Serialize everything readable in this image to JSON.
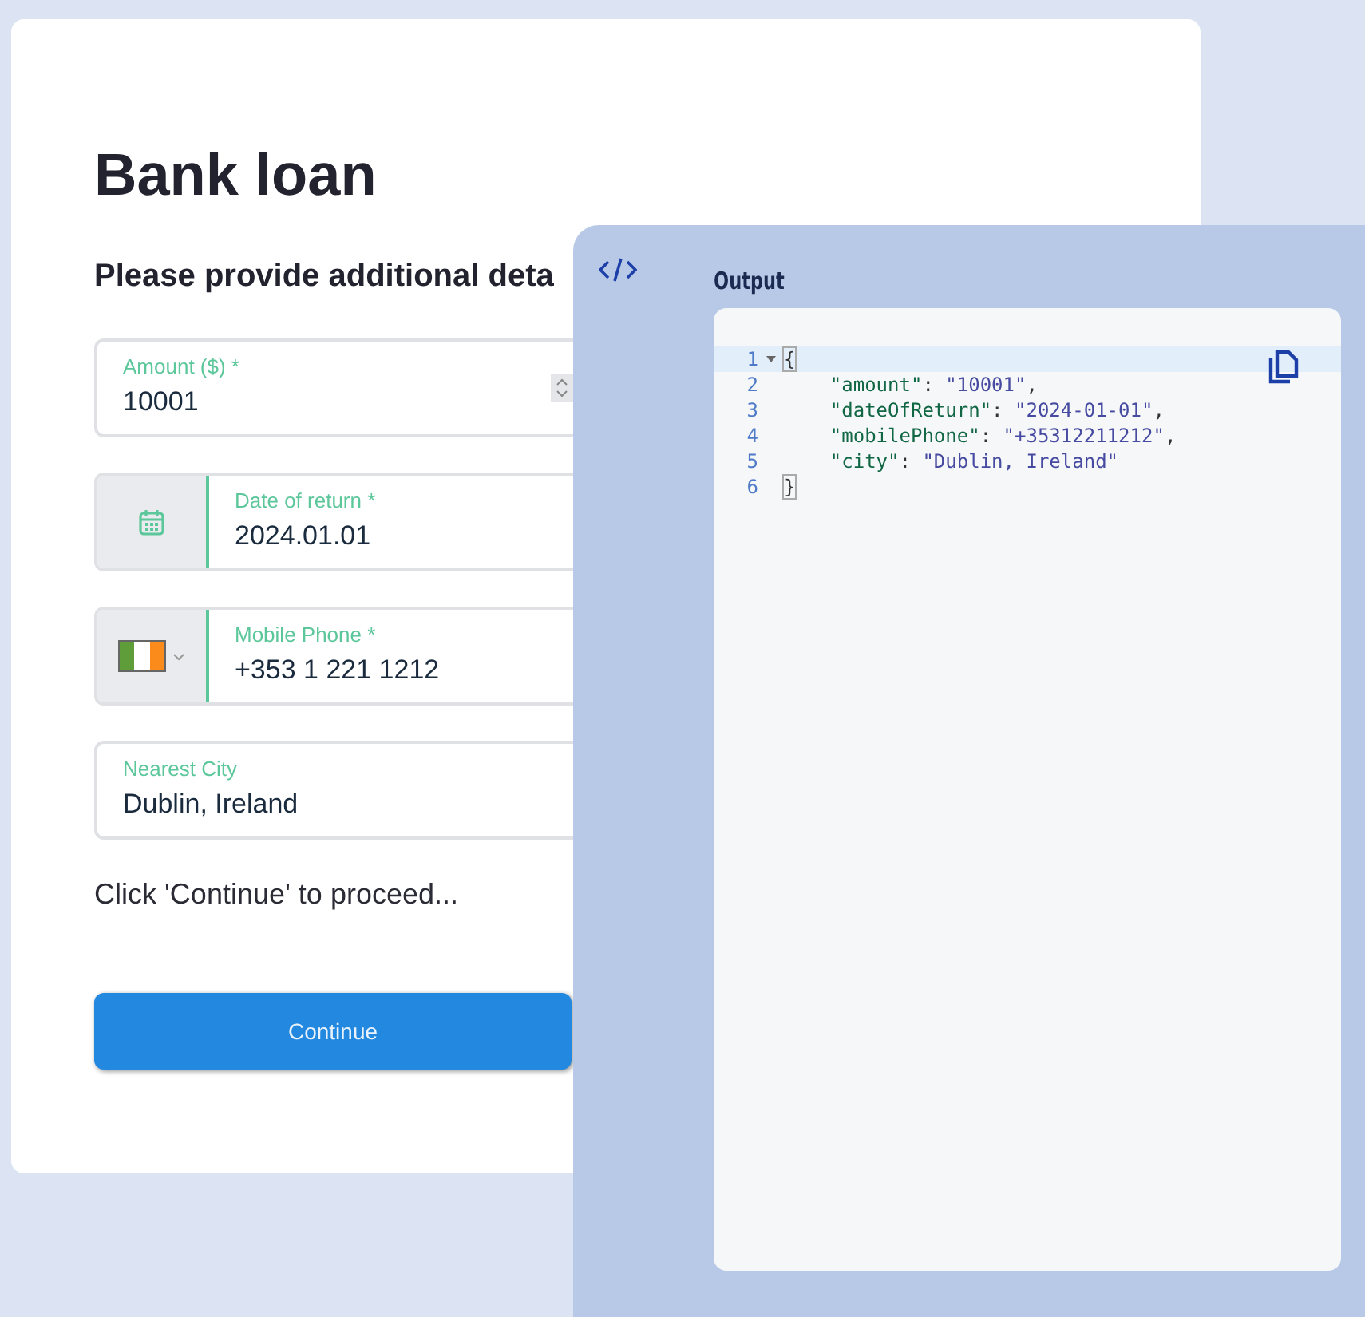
{
  "form": {
    "title": "Bank loan",
    "subtitle": "Please provide additional deta",
    "fields": [
      {
        "kind": "number",
        "label": "Amount ($) *",
        "value": "10001"
      },
      {
        "kind": "date",
        "label": "Date of return *",
        "value": "2024.01.01"
      },
      {
        "kind": "phone",
        "label": "Mobile Phone *",
        "value": "+353 1 221 1212"
      },
      {
        "kind": "text",
        "label": "Nearest City",
        "value": "Dublin, Ireland"
      }
    ],
    "hint": "Click 'Continue' to proceed...",
    "button": "Continue"
  },
  "output": {
    "title": "Output",
    "lines": [
      {
        "number": "1",
        "active": true,
        "foldable": true,
        "tokens": [
          {
            "kind": "bracket",
            "text": "{"
          }
        ]
      },
      {
        "number": "2",
        "active": false,
        "foldable": false,
        "tokens": [
          {
            "kind": "key",
            "text": "    \"amount\""
          },
          {
            "kind": "punct",
            "text": ": "
          },
          {
            "kind": "string",
            "text": "\"10001\""
          },
          {
            "kind": "punct",
            "text": ","
          }
        ]
      },
      {
        "number": "3",
        "active": false,
        "foldable": false,
        "tokens": [
          {
            "kind": "key",
            "text": "    \"dateOfReturn\""
          },
          {
            "kind": "punct",
            "text": ": "
          },
          {
            "kind": "string",
            "text": "\"2024-01-01\""
          },
          {
            "kind": "punct",
            "text": ","
          }
        ]
      },
      {
        "number": "4",
        "active": false,
        "foldable": false,
        "tokens": [
          {
            "kind": "key",
            "text": "    \"mobilePhone\""
          },
          {
            "kind": "punct",
            "text": ": "
          },
          {
            "kind": "string",
            "text": "\"+35312211212\""
          },
          {
            "kind": "punct",
            "text": ","
          }
        ]
      },
      {
        "number": "5",
        "active": false,
        "foldable": false,
        "tokens": [
          {
            "kind": "key",
            "text": "    \"city\""
          },
          {
            "kind": "punct",
            "text": ": "
          },
          {
            "kind": "string",
            "text": "\"Dublin, Ireland\""
          }
        ]
      },
      {
        "number": "6",
        "active": false,
        "foldable": false,
        "tokens": [
          {
            "kind": "bracket",
            "text": "}"
          }
        ]
      }
    ]
  }
}
